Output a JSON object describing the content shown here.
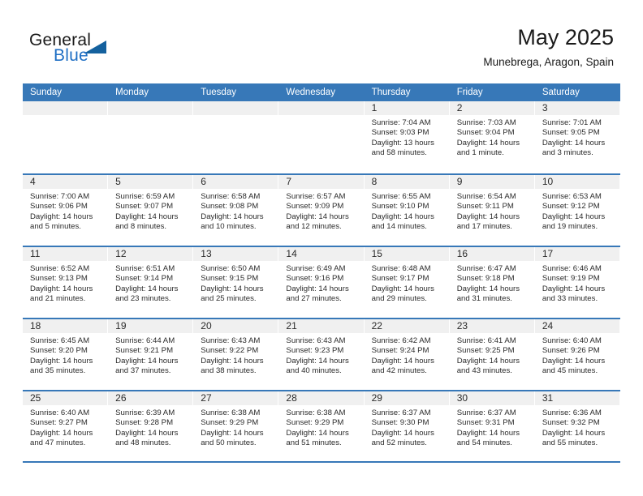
{
  "brand": {
    "line1": "General",
    "line2": "Blue",
    "accent_color": "#14619e",
    "text_color": "#1f6fc4"
  },
  "header": {
    "title": "May 2025",
    "subtitle": "Munebrega, Aragon, Spain",
    "band_color": "#3778b8"
  },
  "weekday_headers": [
    "Sunday",
    "Monday",
    "Tuesday",
    "Wednesday",
    "Thursday",
    "Friday",
    "Saturday"
  ],
  "weeks": [
    [
      {
        "day": "",
        "lines": []
      },
      {
        "day": "",
        "lines": []
      },
      {
        "day": "",
        "lines": []
      },
      {
        "day": "",
        "lines": []
      },
      {
        "day": "1",
        "lines": [
          "Sunrise: 7:04 AM",
          "Sunset: 9:03 PM",
          "Daylight: 13 hours",
          "and 58 minutes."
        ]
      },
      {
        "day": "2",
        "lines": [
          "Sunrise: 7:03 AM",
          "Sunset: 9:04 PM",
          "Daylight: 14 hours",
          "and 1 minute."
        ]
      },
      {
        "day": "3",
        "lines": [
          "Sunrise: 7:01 AM",
          "Sunset: 9:05 PM",
          "Daylight: 14 hours",
          "and 3 minutes."
        ]
      }
    ],
    [
      {
        "day": "4",
        "lines": [
          "Sunrise: 7:00 AM",
          "Sunset: 9:06 PM",
          "Daylight: 14 hours",
          "and 5 minutes."
        ]
      },
      {
        "day": "5",
        "lines": [
          "Sunrise: 6:59 AM",
          "Sunset: 9:07 PM",
          "Daylight: 14 hours",
          "and 8 minutes."
        ]
      },
      {
        "day": "6",
        "lines": [
          "Sunrise: 6:58 AM",
          "Sunset: 9:08 PM",
          "Daylight: 14 hours",
          "and 10 minutes."
        ]
      },
      {
        "day": "7",
        "lines": [
          "Sunrise: 6:57 AM",
          "Sunset: 9:09 PM",
          "Daylight: 14 hours",
          "and 12 minutes."
        ]
      },
      {
        "day": "8",
        "lines": [
          "Sunrise: 6:55 AM",
          "Sunset: 9:10 PM",
          "Daylight: 14 hours",
          "and 14 minutes."
        ]
      },
      {
        "day": "9",
        "lines": [
          "Sunrise: 6:54 AM",
          "Sunset: 9:11 PM",
          "Daylight: 14 hours",
          "and 17 minutes."
        ]
      },
      {
        "day": "10",
        "lines": [
          "Sunrise: 6:53 AM",
          "Sunset: 9:12 PM",
          "Daylight: 14 hours",
          "and 19 minutes."
        ]
      }
    ],
    [
      {
        "day": "11",
        "lines": [
          "Sunrise: 6:52 AM",
          "Sunset: 9:13 PM",
          "Daylight: 14 hours",
          "and 21 minutes."
        ]
      },
      {
        "day": "12",
        "lines": [
          "Sunrise: 6:51 AM",
          "Sunset: 9:14 PM",
          "Daylight: 14 hours",
          "and 23 minutes."
        ]
      },
      {
        "day": "13",
        "lines": [
          "Sunrise: 6:50 AM",
          "Sunset: 9:15 PM",
          "Daylight: 14 hours",
          "and 25 minutes."
        ]
      },
      {
        "day": "14",
        "lines": [
          "Sunrise: 6:49 AM",
          "Sunset: 9:16 PM",
          "Daylight: 14 hours",
          "and 27 minutes."
        ]
      },
      {
        "day": "15",
        "lines": [
          "Sunrise: 6:48 AM",
          "Sunset: 9:17 PM",
          "Daylight: 14 hours",
          "and 29 minutes."
        ]
      },
      {
        "day": "16",
        "lines": [
          "Sunrise: 6:47 AM",
          "Sunset: 9:18 PM",
          "Daylight: 14 hours",
          "and 31 minutes."
        ]
      },
      {
        "day": "17",
        "lines": [
          "Sunrise: 6:46 AM",
          "Sunset: 9:19 PM",
          "Daylight: 14 hours",
          "and 33 minutes."
        ]
      }
    ],
    [
      {
        "day": "18",
        "lines": [
          "Sunrise: 6:45 AM",
          "Sunset: 9:20 PM",
          "Daylight: 14 hours",
          "and 35 minutes."
        ]
      },
      {
        "day": "19",
        "lines": [
          "Sunrise: 6:44 AM",
          "Sunset: 9:21 PM",
          "Daylight: 14 hours",
          "and 37 minutes."
        ]
      },
      {
        "day": "20",
        "lines": [
          "Sunrise: 6:43 AM",
          "Sunset: 9:22 PM",
          "Daylight: 14 hours",
          "and 38 minutes."
        ]
      },
      {
        "day": "21",
        "lines": [
          "Sunrise: 6:43 AM",
          "Sunset: 9:23 PM",
          "Daylight: 14 hours",
          "and 40 minutes."
        ]
      },
      {
        "day": "22",
        "lines": [
          "Sunrise: 6:42 AM",
          "Sunset: 9:24 PM",
          "Daylight: 14 hours",
          "and 42 minutes."
        ]
      },
      {
        "day": "23",
        "lines": [
          "Sunrise: 6:41 AM",
          "Sunset: 9:25 PM",
          "Daylight: 14 hours",
          "and 43 minutes."
        ]
      },
      {
        "day": "24",
        "lines": [
          "Sunrise: 6:40 AM",
          "Sunset: 9:26 PM",
          "Daylight: 14 hours",
          "and 45 minutes."
        ]
      }
    ],
    [
      {
        "day": "25",
        "lines": [
          "Sunrise: 6:40 AM",
          "Sunset: 9:27 PM",
          "Daylight: 14 hours",
          "and 47 minutes."
        ]
      },
      {
        "day": "26",
        "lines": [
          "Sunrise: 6:39 AM",
          "Sunset: 9:28 PM",
          "Daylight: 14 hours",
          "and 48 minutes."
        ]
      },
      {
        "day": "27",
        "lines": [
          "Sunrise: 6:38 AM",
          "Sunset: 9:29 PM",
          "Daylight: 14 hours",
          "and 50 minutes."
        ]
      },
      {
        "day": "28",
        "lines": [
          "Sunrise: 6:38 AM",
          "Sunset: 9:29 PM",
          "Daylight: 14 hours",
          "and 51 minutes."
        ]
      },
      {
        "day": "29",
        "lines": [
          "Sunrise: 6:37 AM",
          "Sunset: 9:30 PM",
          "Daylight: 14 hours",
          "and 52 minutes."
        ]
      },
      {
        "day": "30",
        "lines": [
          "Sunrise: 6:37 AM",
          "Sunset: 9:31 PM",
          "Daylight: 14 hours",
          "and 54 minutes."
        ]
      },
      {
        "day": "31",
        "lines": [
          "Sunrise: 6:36 AM",
          "Sunset: 9:32 PM",
          "Daylight: 14 hours",
          "and 55 minutes."
        ]
      }
    ]
  ]
}
